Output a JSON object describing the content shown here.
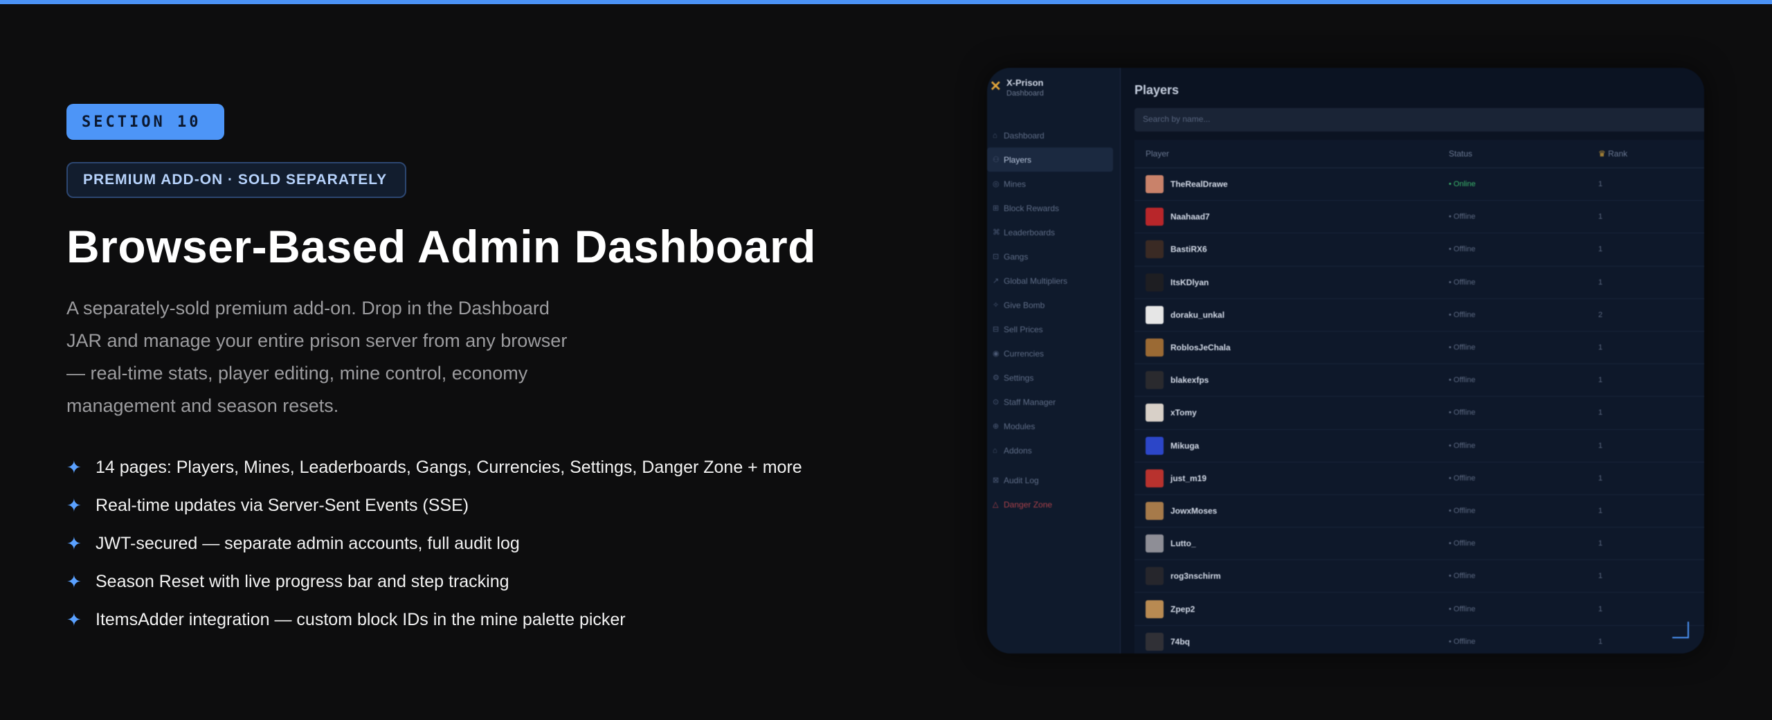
{
  "page": {
    "section_label": "SECTION 10",
    "addon_label": "PREMIUM ADD-ON · SOLD SEPARATELY",
    "headline": "Browser-Based Admin Dashboard",
    "description_lines": [
      "A separately-sold premium add-on. Drop in the Dashboard",
      "JAR and manage your entire prison server from any browser",
      "— real-time stats, player editing, mine control, economy",
      "management and season resets."
    ],
    "features": [
      "14 pages: Players, Mines, Leaderboards, Gangs, Currencies, Settings, Danger Zone + more",
      "Real-time updates via Server-Sent Events (SSE)",
      "JWT-secured — separate admin accounts, full audit log",
      "Season Reset with live progress bar and step tracking",
      "ItemsAdder integration — custom block IDs in the mine palette picker"
    ],
    "feature_icon": "✦"
  },
  "dashboard": {
    "brand_name": "X-Prison",
    "brand_sub": "Dashboard",
    "nav": [
      {
        "label": "Dashboard",
        "icon": "home-icon",
        "glyph": "⌂"
      },
      {
        "label": "Players",
        "icon": "users-icon",
        "glyph": "⚇",
        "active": true
      },
      {
        "label": "Mines",
        "icon": "pickaxe-icon",
        "glyph": "◎"
      },
      {
        "label": "Block Rewards",
        "icon": "gift-icon",
        "glyph": "⊞"
      },
      {
        "label": "Leaderboards",
        "icon": "trophy-icon",
        "glyph": "⌘"
      },
      {
        "label": "Gangs",
        "icon": "shield-icon",
        "glyph": "⊡"
      },
      {
        "label": "Global Multipliers",
        "icon": "trend-icon",
        "glyph": "↗"
      },
      {
        "label": "Give Bomb",
        "icon": "bomb-icon",
        "glyph": "✧"
      },
      {
        "label": "Sell Prices",
        "icon": "tag-icon",
        "glyph": "⊟"
      },
      {
        "label": "Currencies",
        "icon": "coin-icon",
        "glyph": "◉"
      },
      {
        "label": "Settings",
        "icon": "gear-icon",
        "glyph": "⚙"
      },
      {
        "label": "Staff Manager",
        "icon": "staff-icon",
        "glyph": "⊙"
      },
      {
        "label": "Modules",
        "icon": "modules-icon",
        "glyph": "⊕"
      },
      {
        "label": "Addons",
        "icon": "addons-icon",
        "glyph": "⌂"
      },
      {
        "label": "Audit Log",
        "icon": "audit-icon",
        "glyph": "⊠",
        "group": "audit"
      },
      {
        "label": "Danger Zone",
        "icon": "danger-icon",
        "glyph": "△",
        "danger": true
      }
    ],
    "title": "Players",
    "search_placeholder": "Search by name...",
    "columns": {
      "player": "Player",
      "status": "Status",
      "rank": "Rank"
    },
    "rank_icon": "crown-icon",
    "rows": [
      {
        "name": "TheRealDrawe",
        "status": "• Online",
        "rank": "1",
        "online": true,
        "avatar": "#c9826a"
      },
      {
        "name": "Naahaad7",
        "status": "• Offline",
        "rank": "1",
        "avatar": "#b8262a"
      },
      {
        "name": "BastiRX6",
        "status": "• Offline",
        "rank": "1",
        "avatar": "#3a2a24"
      },
      {
        "name": "ItsKDlyan",
        "status": "• Offline",
        "rank": "1",
        "avatar": "#1e1e22"
      },
      {
        "name": "doraku_unkal",
        "status": "• Offline",
        "rank": "2",
        "avatar": "#e6e6e6"
      },
      {
        "name": "RoblosJeChala",
        "status": "• Offline",
        "rank": "1",
        "avatar": "#9b6a34"
      },
      {
        "name": "blakexfps",
        "status": "• Offline",
        "rank": "1",
        "avatar": "#2a2a2e"
      },
      {
        "name": "xTomy",
        "status": "• Offline",
        "rank": "1",
        "avatar": "#d8d0c8"
      },
      {
        "name": "Mikuga",
        "status": "• Offline",
        "rank": "1",
        "avatar": "#2c46c8"
      },
      {
        "name": "just_m19",
        "status": "• Offline",
        "rank": "1",
        "avatar": "#b8322e"
      },
      {
        "name": "JowxMoses",
        "status": "• Offline",
        "rank": "1",
        "avatar": "#a67a4a"
      },
      {
        "name": "Lutto_",
        "status": "• Offline",
        "rank": "1",
        "avatar": "#8e8e96"
      },
      {
        "name": "rog3nschirm",
        "status": "• Offline",
        "rank": "1",
        "avatar": "#26262c"
      },
      {
        "name": "Zpep2",
        "status": "• Offline",
        "rank": "1",
        "avatar": "#b88a52"
      },
      {
        "name": "74bq",
        "status": "• Offline",
        "rank": "1",
        "avatar": "#303036"
      }
    ]
  }
}
